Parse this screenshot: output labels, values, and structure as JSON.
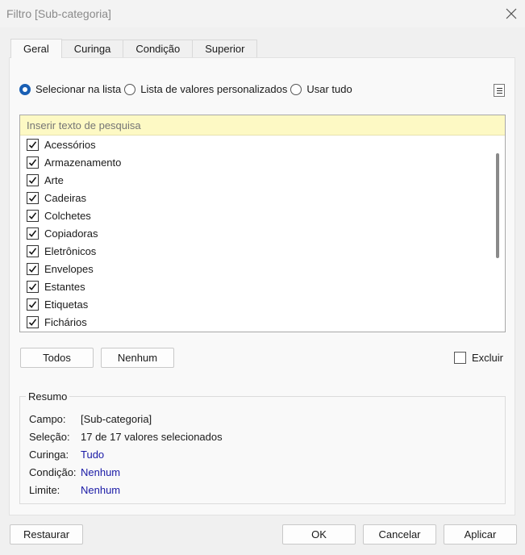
{
  "window": {
    "title": "Filtro [Sub-categoria]"
  },
  "tabs": [
    {
      "label": "Geral",
      "active": true
    },
    {
      "label": "Curinga"
    },
    {
      "label": "Condição"
    },
    {
      "label": "Superior"
    }
  ],
  "radios": [
    {
      "label": "Selecionar na lista",
      "selected": true
    },
    {
      "label": "Lista de valores personalizados"
    },
    {
      "label": "Usar tudo"
    }
  ],
  "search": {
    "placeholder": "Inserir texto de pesquisa"
  },
  "items": [
    {
      "label": "Acessórios",
      "checked": true
    },
    {
      "label": "Armazenamento",
      "checked": true
    },
    {
      "label": "Arte",
      "checked": true
    },
    {
      "label": "Cadeiras",
      "checked": true
    },
    {
      "label": "Colchetes",
      "checked": true
    },
    {
      "label": "Copiadoras",
      "checked": true
    },
    {
      "label": "Eletrônicos",
      "checked": true
    },
    {
      "label": "Envelopes",
      "checked": true
    },
    {
      "label": "Estantes",
      "checked": true
    },
    {
      "label": "Etiquetas",
      "checked": true
    },
    {
      "label": "Fichários",
      "checked": true
    }
  ],
  "buttons": {
    "all": "Todos",
    "none": "Nenhum",
    "exclude": "Excluir",
    "reset": "Restaurar",
    "ok": "OK",
    "cancel": "Cancelar",
    "apply": "Aplicar"
  },
  "summary": {
    "title": "Resumo",
    "rows": [
      {
        "label": "Campo:",
        "value": "[Sub-categoria]"
      },
      {
        "label": "Seleção:",
        "value": "17 de 17 valores selecionados"
      },
      {
        "label": "Curinga:",
        "value": "Tudo"
      },
      {
        "label": "Condição:",
        "value": "Nenhum"
      },
      {
        "label": "Limite:",
        "value": "Nenhum"
      }
    ]
  },
  "colors": {
    "accent": "#1a5fb4",
    "link": "#1a1aa6",
    "search_bg": "#fdf9c4"
  }
}
